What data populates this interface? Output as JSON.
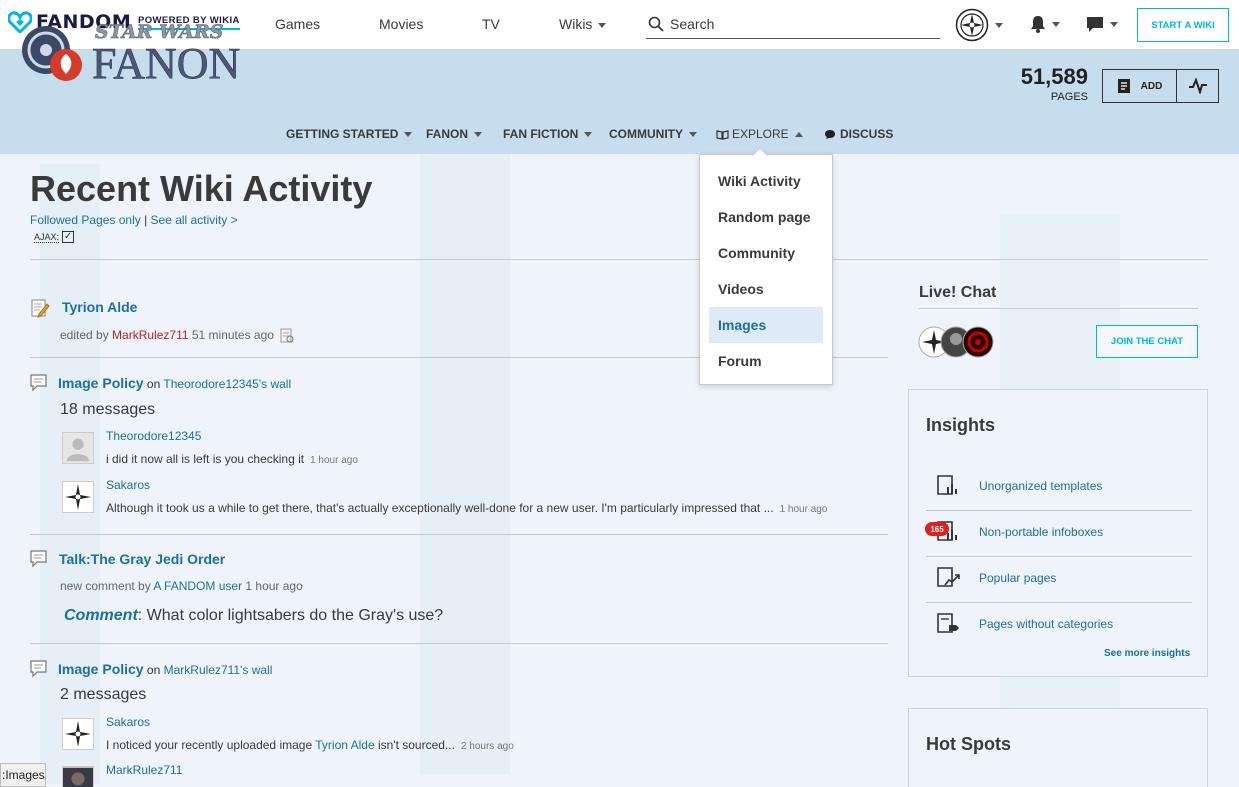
{
  "topbar": {
    "brand": "FANDOM",
    "powered": "POWERED BY WIKIA",
    "nav": [
      "Games",
      "Movies",
      "TV",
      "Wikis"
    ],
    "search_placeholder": "Search",
    "start_wiki": "START A WIKI",
    "accent": "#00b7e0"
  },
  "wiki": {
    "logo_top": "STAR WARS",
    "logo_main": "FANON",
    "page_count": "51,589",
    "pages_label": "PAGES",
    "add_label": "ADD",
    "nav": [
      "GETTING STARTED",
      "FANON",
      "FAN FICTION",
      "COMMUNITY",
      "EXPLORE",
      "DISCUSS"
    ]
  },
  "explore_menu": [
    "Wiki Activity",
    "Random page",
    "Community",
    "Videos",
    "Images",
    "Forum"
  ],
  "page": {
    "title": "Recent Wiki Activity",
    "followed": "Followed Pages only",
    "separator": " | ",
    "see_all": "See all activity >",
    "ajax": "AJAX:"
  },
  "activity": [
    {
      "title": "Tyrion Alde",
      "meta_prefix": "edited by ",
      "user": "MarkRulez711",
      "time": " 51 minutes ago"
    },
    {
      "title": "Image Policy",
      "on": " on ",
      "wall": "Theorodore12345's wall",
      "count": "18 messages",
      "replies": [
        {
          "user": "Theorodore12345",
          "text": "i did it now all is left is you checking it",
          "time": "1 hour ago"
        },
        {
          "user": "Sakaros",
          "text": "Although it took us a while to get there, that's actually exceptionally well-done for a new user. I'm particularly impressed that ...",
          "time": "1 hour ago"
        }
      ]
    },
    {
      "title": "Talk:The Gray Jedi Order",
      "meta_prefix": "new comment by ",
      "user": "A FANDOM user",
      "time": " 1 hour ago",
      "comment_label": "Comment",
      "comment_text": ": What color lightsabers do the Gray's use?"
    },
    {
      "title": "Image Policy",
      "on": " on ",
      "wall": "MarkRulez711's wall",
      "count": "2 messages",
      "replies": [
        {
          "user": "Sakaros",
          "text_before": "I noticed your recently uploaded image ",
          "link": "Tyrion Alde",
          "text_after": " isn't sourced...",
          "time": "2 hours ago"
        },
        {
          "user": "MarkRulez711"
        }
      ]
    }
  ],
  "rail": {
    "chat_title": "Live! Chat",
    "join_chat": "JOIN THE CHAT",
    "insights_title": "Insights",
    "insights": [
      "Unorganized templates",
      "Non-portable infoboxes",
      "Popular pages",
      "Pages without categories"
    ],
    "insights_badge": "165",
    "see_more": "See more insights",
    "hotspots_title": "Hot Spots"
  },
  "statusbar": ":Images"
}
